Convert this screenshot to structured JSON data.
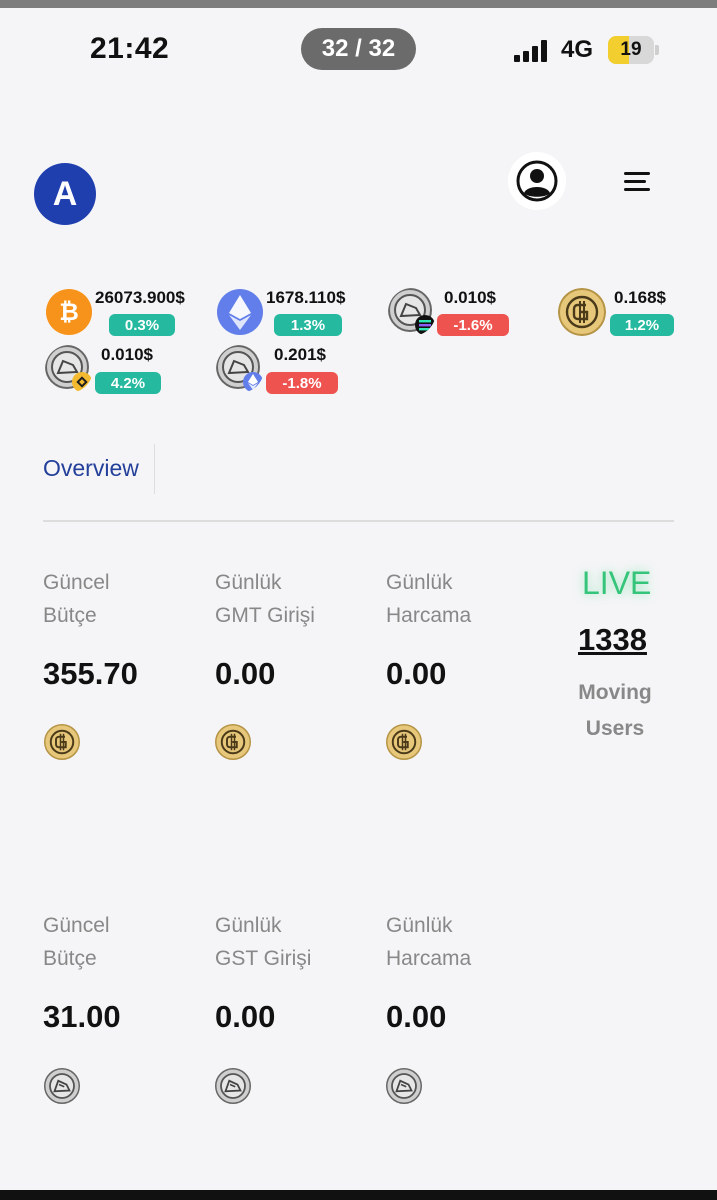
{
  "status_bar": {
    "time": "21:42",
    "page_indicator": "32 / 32",
    "network": "4G",
    "battery": "19",
    "battery_level": 0.19
  },
  "header": {
    "logo_letter": "A",
    "user_icon": "user-circle-icon",
    "menu_icon": "hamburger-menu-icon"
  },
  "ticker": [
    {
      "icon": "bitcoin-icon",
      "price": "26073.900$",
      "change": "0.3%",
      "direction": "up"
    },
    {
      "icon": "ethereum-icon",
      "price": "1678.110$",
      "change": "1.3%",
      "direction": "up"
    },
    {
      "icon": "gst-solana-icon",
      "price": "0.010$",
      "change": "-1.6%",
      "direction": "down"
    },
    {
      "icon": "gmt-coin-icon",
      "price": "0.168$",
      "change": "1.2%",
      "direction": "up"
    },
    {
      "icon": "gst-bsc-icon",
      "price": "0.010$",
      "change": "4.2%",
      "direction": "up"
    },
    {
      "icon": "gst-eth-icon",
      "price": "0.201$",
      "change": "-1.8%",
      "direction": "down"
    }
  ],
  "tabs": {
    "overview": "Overview"
  },
  "gmt_stats": [
    {
      "label1": "Güncel",
      "label2": "Bütçe",
      "value": "355.70"
    },
    {
      "label1": "Günlük",
      "label2": "GMT Girişi",
      "value": "0.00"
    },
    {
      "label1": "Günlük",
      "label2": "Harcama",
      "value": "0.00"
    }
  ],
  "gst_stats": [
    {
      "label1": "Güncel",
      "label2": "Bütçe",
      "value": "31.00"
    },
    {
      "label1": "Günlük",
      "label2": "GST Girişi",
      "value": "0.00"
    },
    {
      "label1": "Günlük",
      "label2": "Harcama",
      "value": "0.00"
    }
  ],
  "live": {
    "label": "LIVE",
    "count": "1338",
    "desc1": "Moving",
    "desc2": "Users"
  },
  "colors": {
    "positive": "#25b9a0",
    "negative": "#ef5350",
    "live": "#35c57a",
    "logo": "#1f3fae",
    "tab": "#24409a"
  }
}
